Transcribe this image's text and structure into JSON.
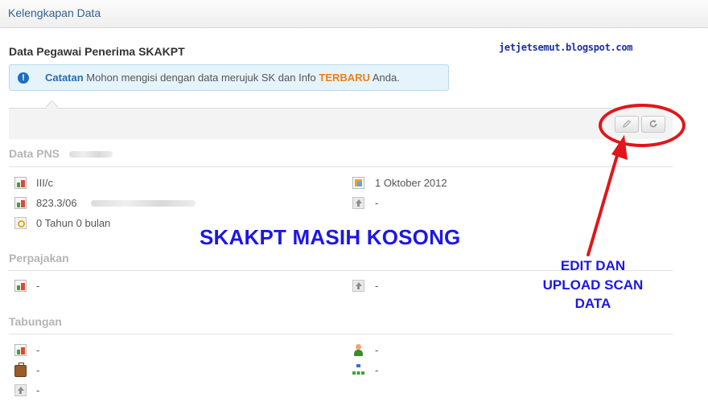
{
  "header": {
    "title": "Kelengkapan Data"
  },
  "page": {
    "title": "Data Pegawai Penerima SKAKPT"
  },
  "watermark": "jetjetsemut.blogspot.com",
  "alert": {
    "label": "Catatan",
    "text_before": " Mohon mengisi dengan data merujuk SK dan Info ",
    "highlight": "TERBARU",
    "text_after": " Anda."
  },
  "toolbar": {
    "edit_icon": "pencil-icon",
    "refresh_icon": "refresh-icon"
  },
  "sections": {
    "pns": {
      "title": "Data PNS",
      "items": {
        "golongan": "III/c",
        "tmt": "1 Oktober 2012",
        "sk_number": "823.3/06",
        "upload": "-",
        "masa_kerja": "0 Tahun 0 bulan"
      }
    },
    "pajak": {
      "title": "Perpajakan",
      "items": {
        "npwp": "-",
        "upload": "-"
      }
    },
    "tabungan": {
      "title": "Tabungan",
      "items": {
        "rekening": "-",
        "atas_nama": "-",
        "bank": "-",
        "cabang": "-",
        "upload": "-"
      }
    }
  },
  "annotations": {
    "main": "SKAKPT MASIH KOSONG",
    "note_lines": [
      "EDIT DAN",
      "UPLOAD SCAN",
      "DATA"
    ]
  },
  "colors": {
    "annotation_red": "#e0161b",
    "annotation_blue": "#1c17e6",
    "link_blue": "#34628f",
    "highlight_orange": "#f07e1a"
  }
}
